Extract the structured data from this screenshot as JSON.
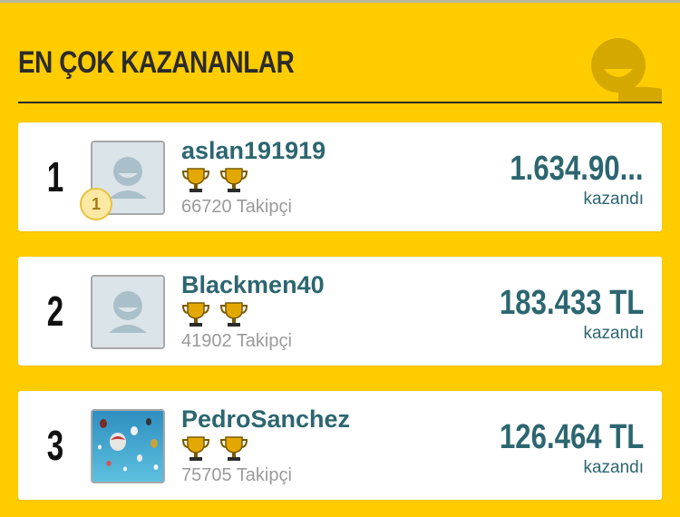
{
  "header": {
    "title": "EN ÇOK KAZANANLAR"
  },
  "leaders": [
    {
      "rank": "1",
      "username": "aslan191919",
      "followers": "66720 Takipçi",
      "amount": "1.634.90...",
      "won_label": "kazandı",
      "badge": "1",
      "trophies": 2,
      "avatar": "default-avatar-icon"
    },
    {
      "rank": "2",
      "username": "Blackmen40",
      "followers": "41902 Takipçi",
      "amount": "183.433 TL",
      "won_label": "kazandı",
      "trophies": 2,
      "avatar": "default-avatar-icon"
    },
    {
      "rank": "3",
      "username": "PedroSanchez",
      "followers": "75705 Takipçi",
      "amount": "126.464 TL",
      "won_label": "kazandı",
      "trophies": 2,
      "avatar": "hot-air-balloons-photo"
    }
  ],
  "colors": {
    "background": "#FFCC00",
    "accent": "#2C6670",
    "card": "#FFFFFF"
  }
}
